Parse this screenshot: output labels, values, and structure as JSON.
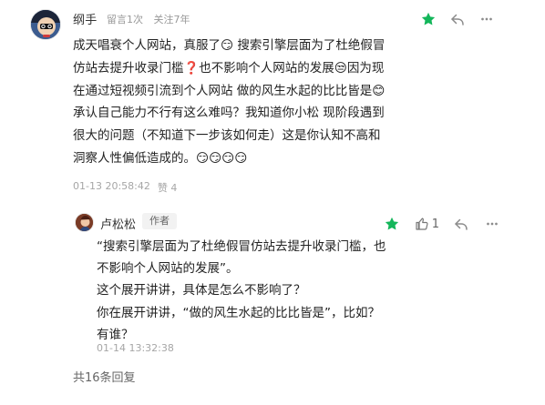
{
  "comment": {
    "author": "纲手",
    "message_count_text": "留言1次",
    "follow_text": "关注7年",
    "body": "成天唱衰个人网站，真服了😏 搜索引擎层面为了杜绝假冒仿站去提升收录门槛❓也不影响个人网站的发展😒因为现在通过短视频引流到个人网站 做的风生水起的比比皆是😊 承认自己能力不行有这么难吗？我知道你小松 现阶段遇到很大的问题（不知道下一步该如何走）这是你认知不高和洞察人性偏低造成的。😏😏😏😏",
    "datetime": "01-13 20:58:42",
    "like_text": "赞 4"
  },
  "reply": {
    "author": "卢松松",
    "badge": "作者",
    "like_count": "1",
    "body": "“搜索引擎层面为了杜绝假冒仿站去提升收录门槛，也不影响个人网站的发展”。\n这个展开讲讲，具体是怎么不影响了？\n你在展开讲讲，“做的风生水起的比比皆是”，比如？有谁？",
    "datetime": "01-14 13:32:38"
  },
  "replies_link": "共16条回复",
  "icons": {
    "star": "star-icon",
    "reply": "reply-icon",
    "more": "more-icon",
    "thumb": "thumb-up-icon"
  },
  "colors": {
    "star": "#13b65a",
    "muted": "#999999"
  }
}
